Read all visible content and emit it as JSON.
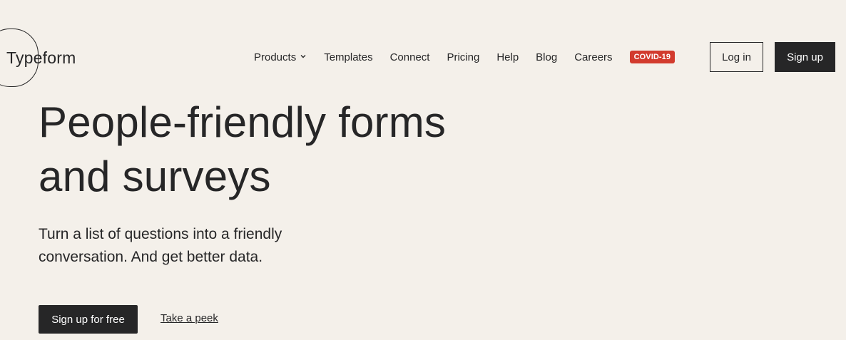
{
  "header": {
    "logo_text": "Typeform",
    "nav": [
      {
        "label": "Products"
      },
      {
        "label": "Templates"
      },
      {
        "label": "Connect"
      },
      {
        "label": "Pricing"
      },
      {
        "label": "Help"
      },
      {
        "label": "Blog"
      },
      {
        "label": "Careers"
      }
    ],
    "badge": "COVID-19",
    "login_label": "Log in",
    "signup_label": "Sign up"
  },
  "hero": {
    "title_line1": "People-friendly forms",
    "title_line2": "and surveys",
    "subtitle_line1": "Turn a list of questions into a friendly",
    "subtitle_line2": "conversation. And get better data.",
    "cta_primary": "Sign up for free",
    "cta_secondary": "Take a peek"
  },
  "colors": {
    "background": "#f4f0ea",
    "text": "#262627",
    "badge": "#d23b2e"
  }
}
